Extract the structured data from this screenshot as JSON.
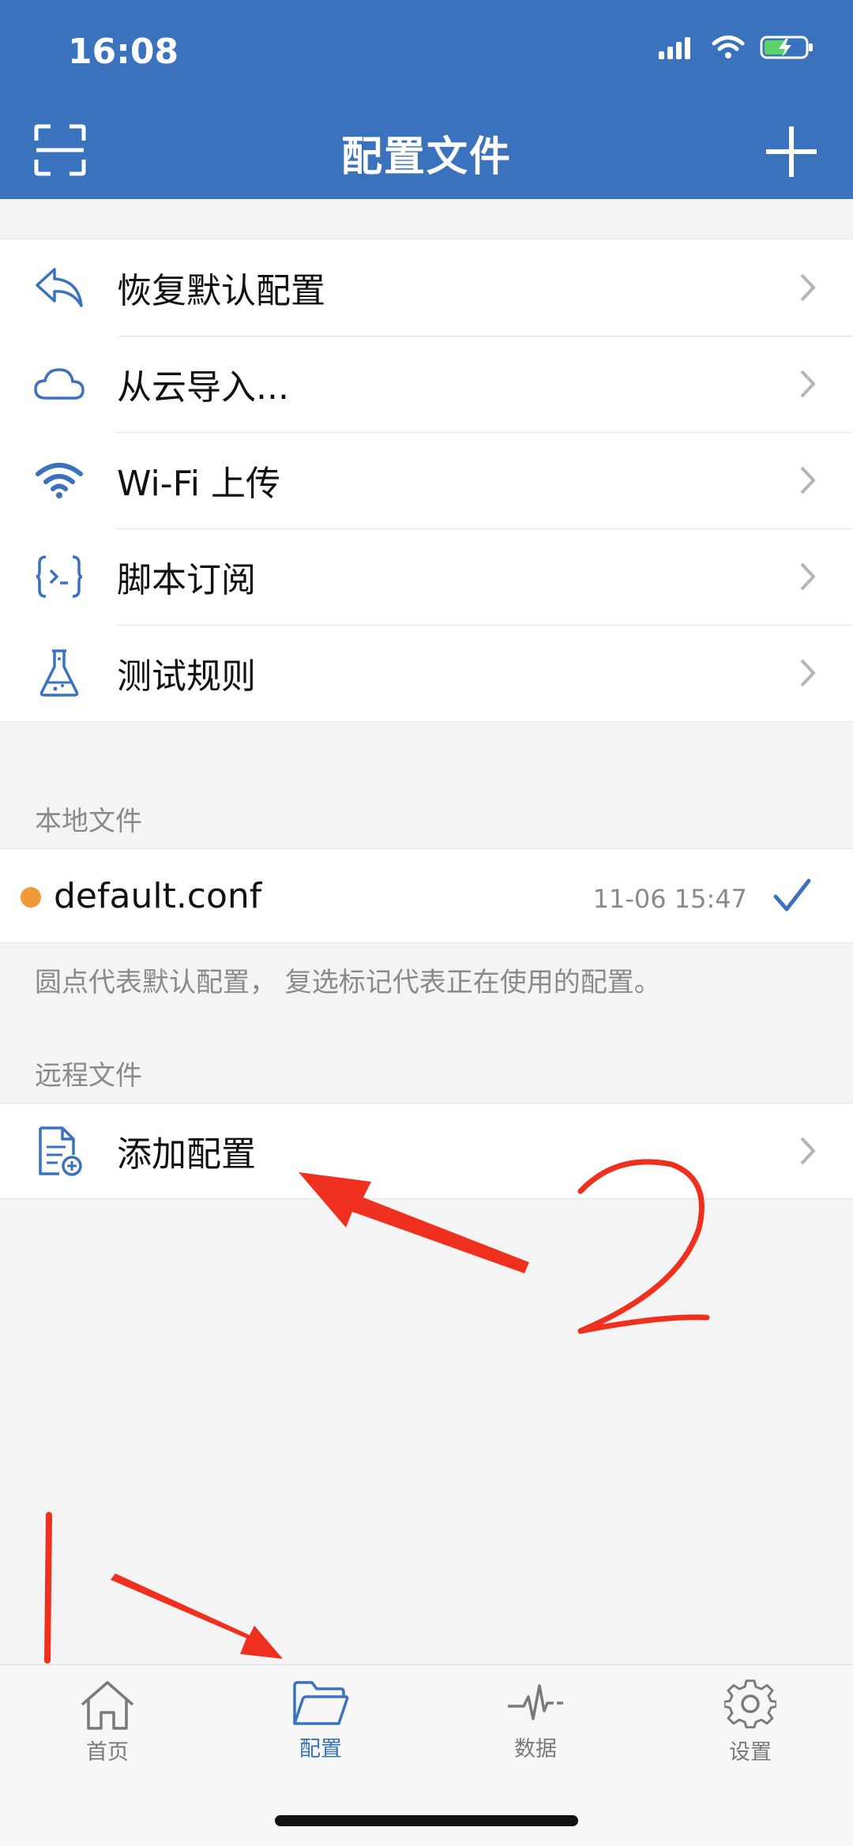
{
  "status_bar": {
    "time": "16:08"
  },
  "nav": {
    "title": "配置文件",
    "scan_icon": "scan-icon",
    "add_icon": "plus-icon"
  },
  "menu": {
    "items": [
      {
        "label": "恢复默认配置",
        "icon": "undo-arrow-icon"
      },
      {
        "label": "从云导入...",
        "icon": "cloud-icon"
      },
      {
        "label": "Wi-Fi 上传",
        "icon": "wifi-icon"
      },
      {
        "label": "脚本订阅",
        "icon": "script-braces-icon"
      },
      {
        "label": "测试规则",
        "icon": "flask-icon"
      }
    ]
  },
  "local": {
    "section_title": "本地文件",
    "file": {
      "name": "default.conf",
      "time": "11-06 15:47",
      "default_dot_color": "#f29a37",
      "active": true
    },
    "note": "圆点代表默认配置， 复选标记代表正在使用的配置。"
  },
  "remote": {
    "section_title": "远程文件",
    "add_label": "添加配置"
  },
  "tabbar": {
    "tabs": [
      {
        "label": "首页",
        "icon": "home-icon",
        "active": false
      },
      {
        "label": "配置",
        "icon": "folder-icon",
        "active": true
      },
      {
        "label": "数据",
        "icon": "pulse-icon",
        "active": false
      },
      {
        "label": "设置",
        "icon": "gear-icon",
        "active": false
      }
    ]
  },
  "colors": {
    "accent": "#3a72bd",
    "annotation": "#f0301e"
  },
  "annotations": {
    "mark_1": "1",
    "mark_2": "2"
  }
}
